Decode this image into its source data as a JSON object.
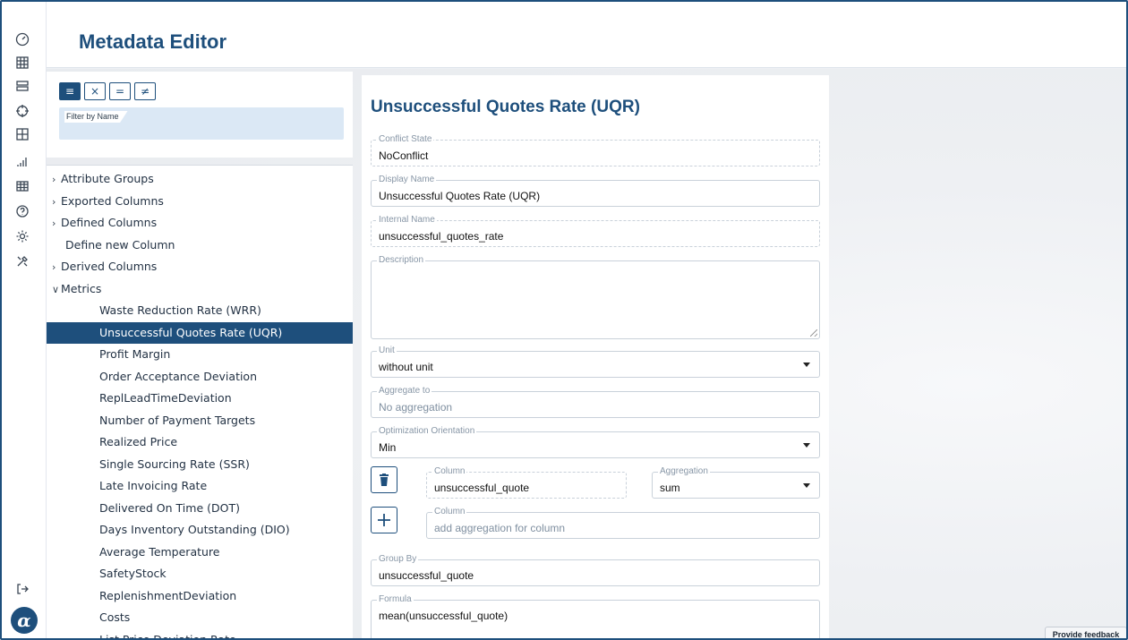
{
  "app": {
    "title": "Metadata Editor",
    "brand_logo": "α",
    "accent_color": "#1e4f7c"
  },
  "rail": {
    "icons": [
      "speedometer-icon",
      "dashboard-grid-icon",
      "layers-icon",
      "crosshair-icon",
      "table-plus-icon",
      "signal-bars-icon",
      "table-icon",
      "help-icon",
      "settings-gear-icon",
      "tools-icon",
      "logout-icon"
    ]
  },
  "filter": {
    "modes": [
      "≡",
      "×",
      "=",
      "≠"
    ],
    "label": "Filter by Name",
    "value": ""
  },
  "tree": {
    "items": [
      {
        "label": "Attribute Groups",
        "caret": "›",
        "level": 0
      },
      {
        "label": "Exported Columns",
        "caret": "›",
        "level": 0
      },
      {
        "label": "Defined Columns",
        "caret": "›",
        "level": 0
      },
      {
        "label": "Define new Column",
        "caret": "",
        "level": 0
      },
      {
        "label": "Derived Columns",
        "caret": "›",
        "level": 0
      },
      {
        "label": "Metrics",
        "caret": "∨",
        "level": 0
      },
      {
        "label": "Waste Reduction Rate (WRR)",
        "caret": "",
        "level": 1
      },
      {
        "label": "Unsuccessful Quotes Rate (UQR)",
        "caret": "",
        "level": 1,
        "selected": true
      },
      {
        "label": "Profit Margin",
        "caret": "",
        "level": 1
      },
      {
        "label": "Order Acceptance Deviation",
        "caret": "",
        "level": 1
      },
      {
        "label": "ReplLeadTimeDeviation",
        "caret": "",
        "level": 1
      },
      {
        "label": "Number of Payment Targets",
        "caret": "",
        "level": 1
      },
      {
        "label": "Realized Price",
        "caret": "",
        "level": 1
      },
      {
        "label": "Single Sourcing Rate (SSR)",
        "caret": "",
        "level": 1
      },
      {
        "label": "Late Invoicing Rate",
        "caret": "",
        "level": 1
      },
      {
        "label": "Delivered On Time (DOT)",
        "caret": "",
        "level": 1
      },
      {
        "label": "Days Inventory Outstanding (DIO)",
        "caret": "",
        "level": 1
      },
      {
        "label": "Average Temperature",
        "caret": "",
        "level": 1
      },
      {
        "label": "SafetyStock",
        "caret": "",
        "level": 1
      },
      {
        "label": "ReplenishmentDeviation",
        "caret": "",
        "level": 1
      },
      {
        "label": "Costs",
        "caret": "",
        "level": 1
      },
      {
        "label": "List Price Deviation Rate",
        "caret": "",
        "level": 1
      }
    ]
  },
  "form": {
    "title": "Unsuccessful Quotes Rate (UQR)",
    "conflict_state": {
      "label": "Conflict State",
      "value": "NoConflict"
    },
    "display_name": {
      "label": "Display Name",
      "value": "Unsuccessful Quotes Rate (UQR)"
    },
    "internal_name": {
      "label": "Internal Name",
      "value": "unsuccessful_quotes_rate"
    },
    "description": {
      "label": "Description",
      "value": ""
    },
    "unit": {
      "label": "Unit",
      "value": "without unit"
    },
    "aggregate_to": {
      "label": "Aggregate to",
      "value": "No aggregation"
    },
    "optimization": {
      "label": "Optimization Orientation",
      "value": "Min"
    },
    "aggregation_row": {
      "column_label": "Column",
      "column_value": "unsuccessful_quote",
      "aggregation_label": "Aggregation",
      "aggregation_value": "sum"
    },
    "new_aggregation": {
      "column_label": "Column",
      "placeholder": "add aggregation for column"
    },
    "group_by": {
      "label": "Group By",
      "value": "unsuccessful_quote"
    },
    "formula": {
      "label": "Formula",
      "value": "mean(unsuccessful_quote)"
    }
  },
  "feedback": {
    "label": "Provide feedback"
  }
}
